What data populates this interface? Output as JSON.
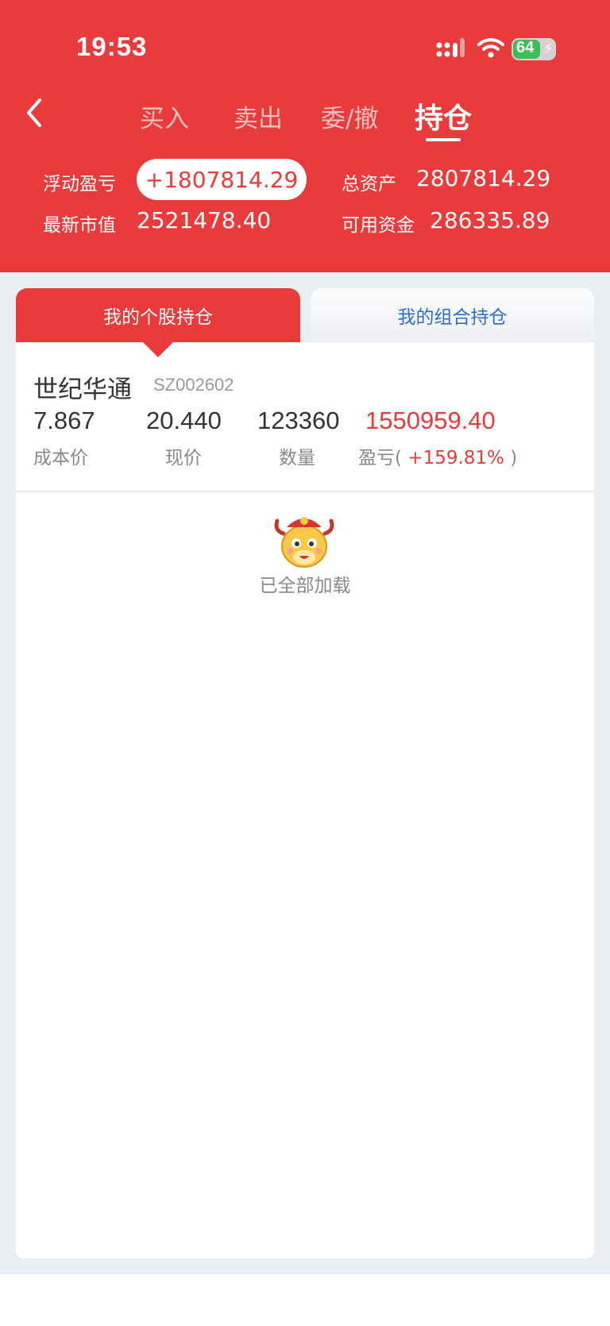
{
  "status_bar": {
    "time": "19:53",
    "battery": "64"
  },
  "tabs": [
    {
      "label": "买入"
    },
    {
      "label": "卖出"
    },
    {
      "label": "委/撤"
    },
    {
      "label": "持仓"
    }
  ],
  "summary": {
    "floating_pl_label": "浮动盈亏",
    "floating_pl_value": "+1807814.29",
    "total_assets_label": "总资产",
    "total_assets_value": "2807814.29",
    "market_value_label": "最新市值",
    "market_value_value": "2521478.40",
    "available_funds_label": "可用资金",
    "available_funds_value": "286335.89"
  },
  "segments": {
    "individual": "我的个股持仓",
    "portfolio": "我的组合持仓"
  },
  "position": {
    "name": "世纪华通",
    "code": "SZ002602",
    "cost_price": "7.867",
    "current_price": "20.440",
    "quantity": "123360",
    "pl_amount": "1550959.40",
    "cost_price_label": "成本价",
    "current_price_label": "现价",
    "quantity_label": "数量",
    "pl_label_prefix": "盈亏(",
    "pl_percent": "+159.81%",
    "pl_label_suffix": ")"
  },
  "footer_text": "已全部加载",
  "colors": {
    "brand_red": "#e93a3c",
    "link_blue": "#2f6ecb"
  }
}
